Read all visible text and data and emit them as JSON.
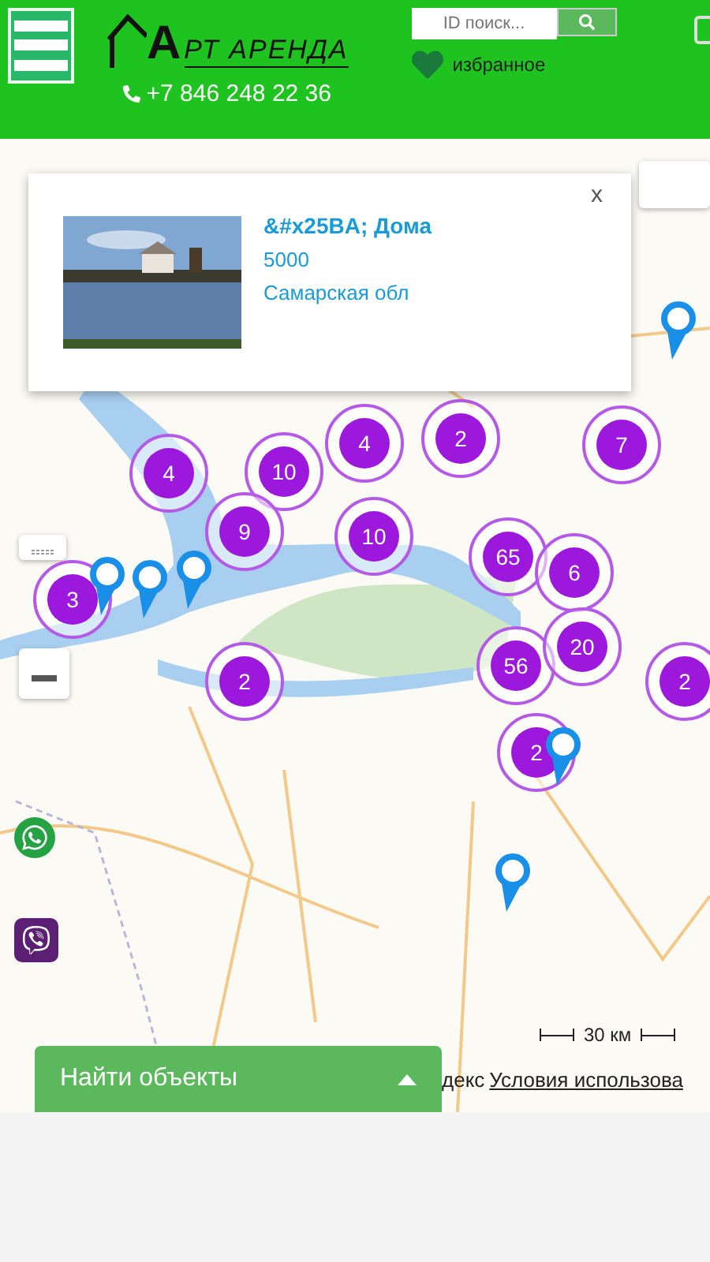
{
  "header": {
    "logo": {
      "letter": "А",
      "rest": "РТ АРЕНДА"
    },
    "phone": "+7 846 248 22 36",
    "search": {
      "placeholder": "ID поиск..."
    },
    "favorites": "избранное"
  },
  "popup": {
    "close": "x",
    "title": "&#x25BA; Дома",
    "price": "5000",
    "region": "Самарская обл"
  },
  "clusters": [
    {
      "count": "4"
    },
    {
      "count": "10"
    },
    {
      "count": "9"
    },
    {
      "count": "4"
    },
    {
      "count": "2"
    },
    {
      "count": "7"
    },
    {
      "count": "10"
    },
    {
      "count": "65"
    },
    {
      "count": "6"
    },
    {
      "count": "56"
    },
    {
      "count": "20"
    },
    {
      "count": "3"
    },
    {
      "count": "2"
    },
    {
      "count": "2"
    },
    {
      "count": "2"
    }
  ],
  "scale": "30 км",
  "attribution": {
    "brand": "декс",
    "terms": "Условия использова"
  },
  "find_panel": {
    "label": "Найти объекты",
    "expanded": false
  }
}
